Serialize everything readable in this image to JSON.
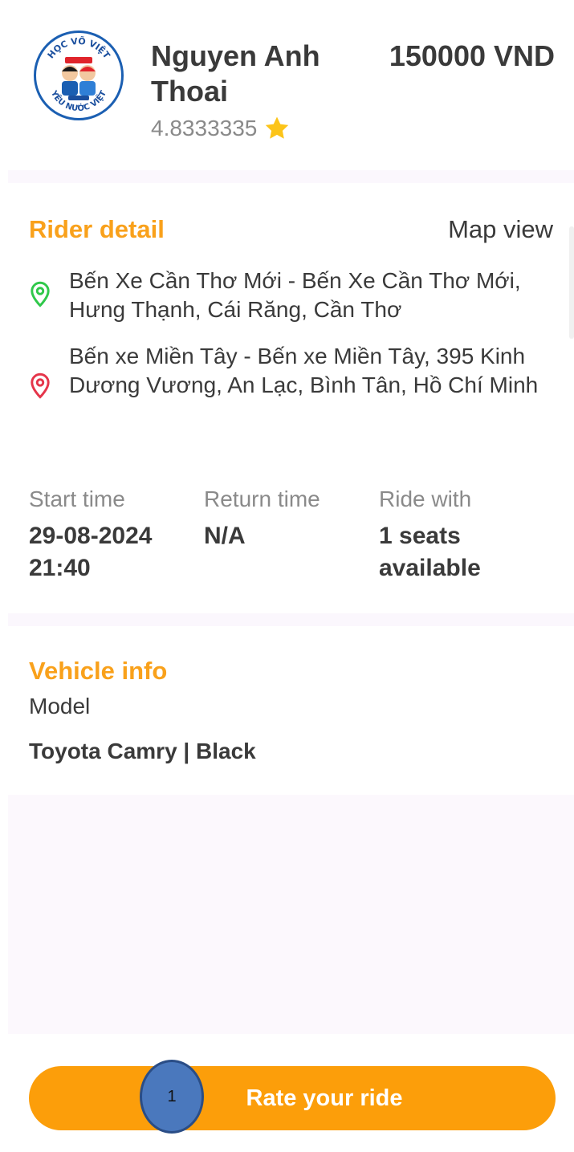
{
  "driver": {
    "name": "Nguyen Anh Thoai",
    "rating": "4.8333335",
    "price": "150000 VND",
    "logo_top": "HỌC VÕ VIỆT",
    "logo_bottom": "YÊU NƯỚC VIỆT"
  },
  "rider_detail": {
    "title": "Rider detail",
    "map_view_label": "Map view",
    "pickup": "Bến Xe Cần Thơ Mới - Bến Xe Cần Thơ Mới, Hưng Thạnh, Cái Răng, Cần Thơ",
    "dropoff": "Bến xe Miền Tây - Bến xe Miền Tây, 395 Kinh Dương Vương, An Lạc, Bình Tân, Hồ Chí Minh"
  },
  "ride_info": {
    "start_label": "Start time",
    "start_value": "29-08-2024 21:40",
    "return_label": "Return time",
    "return_value": "N/A",
    "ride_with_label": "Ride with",
    "ride_with_value": "1 seats available"
  },
  "vehicle": {
    "title": "Vehicle info",
    "model_label": "Model",
    "model_value": "Toyota Camry | Black"
  },
  "actions": {
    "rate_label": "Rate your ride",
    "step_number": "1"
  },
  "icons": {
    "rating": "star-icon",
    "pickup": "map-pin-green-icon",
    "dropoff": "map-pin-red-icon"
  },
  "colors": {
    "accent": "#f9a11b",
    "button": "#fc9e0a",
    "pickup_pin": "#2fc84a",
    "dropoff_pin": "#e5354a",
    "badge": "#4a78bd"
  }
}
